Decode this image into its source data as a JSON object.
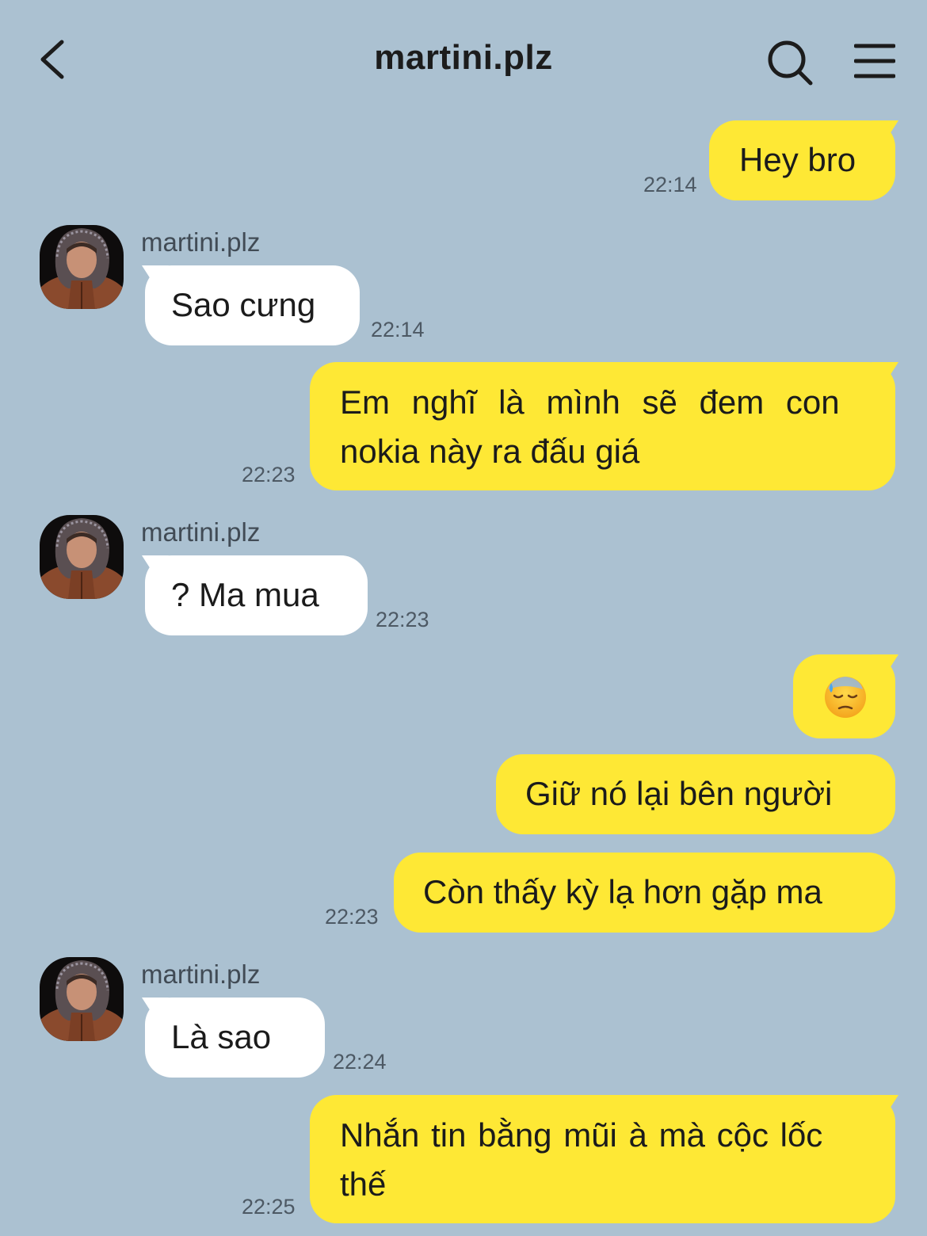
{
  "header": {
    "title": "martini.plz"
  },
  "messages": [
    {
      "text": "Hey bro",
      "time": "22:14"
    },
    {
      "sender": "martini.plz",
      "text": "Sao cưng",
      "time": "22:14"
    },
    {
      "line1": "Em nghĩ là mình sẽ đem con",
      "line2": "nokia này ra đấu giá",
      "time": "22:23"
    },
    {
      "sender": "martini.plz",
      "text": "? Ma mua",
      "time": "22:23"
    },
    {
      "emoji": "😓"
    },
    {
      "text": "Giữ nó lại bên người"
    },
    {
      "text": "Còn thấy kỳ lạ hơn gặp ma",
      "time": "22:23"
    },
    {
      "sender": "martini.plz",
      "text": "Là sao",
      "time": "22:24"
    },
    {
      "line1": "Nhắn tin bằng mũi à mà cộc lốc",
      "line2": "thế",
      "time": "22:25"
    }
  ],
  "colors": {
    "background": "#abc1d1",
    "outgoing_bubble": "#fee835",
    "incoming_bubble": "#ffffff"
  },
  "icons": [
    "back-chevron-icon",
    "search-icon",
    "menu-icon",
    "avatar-image"
  ]
}
